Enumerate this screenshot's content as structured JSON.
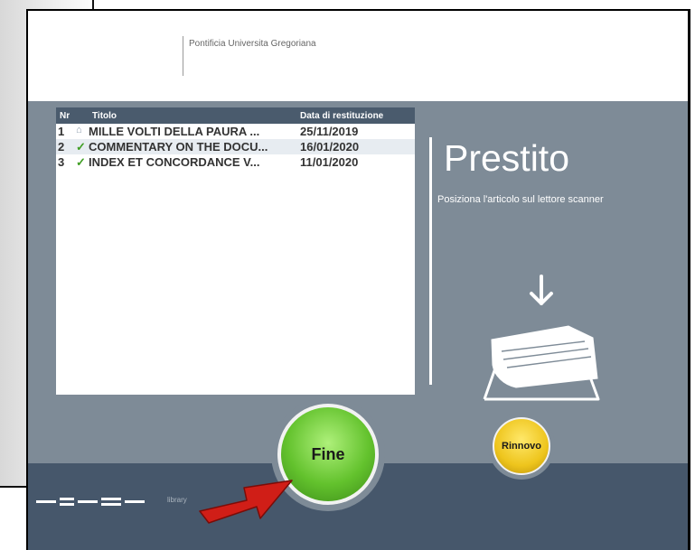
{
  "header": {
    "institution": "Pontificia Universita Gregoriana"
  },
  "table": {
    "columns": {
      "nr": "Nr",
      "title": "Titolo",
      "date": "Data di restituzione"
    },
    "rows": [
      {
        "nr": "1",
        "icon": "home-icon",
        "glyph": "⌂",
        "title": "MILLE VOLTI DELLA PAURA ...",
        "date": "25/11/2019"
      },
      {
        "nr": "2",
        "icon": "checkmark-icon",
        "glyph": "✓",
        "title": "COMMENTARY ON THE DOCU...",
        "date": "16/01/2020"
      },
      {
        "nr": "3",
        "icon": "checkmark-icon",
        "glyph": "✓",
        "title": "INDEX ET CONCORDANCE V...",
        "date": "11/01/2020"
      }
    ]
  },
  "panel": {
    "title": "Prestito",
    "hint": "Posiziona l'articolo sul lettore scanner"
  },
  "buttons": {
    "fine": "Fine",
    "rinnovo": "Rinnovo"
  },
  "footer": {
    "brand": "nedap",
    "product": "library"
  },
  "colors": {
    "panel_bg": "#7e8b97",
    "table_header": "#4a5b6d",
    "bottom_bar": "#46576b",
    "fine_green": "#63c22d",
    "rinnovo_yellow": "#eec51d",
    "arrow_red": "#d01e17",
    "check_green": "#3f9e23"
  }
}
